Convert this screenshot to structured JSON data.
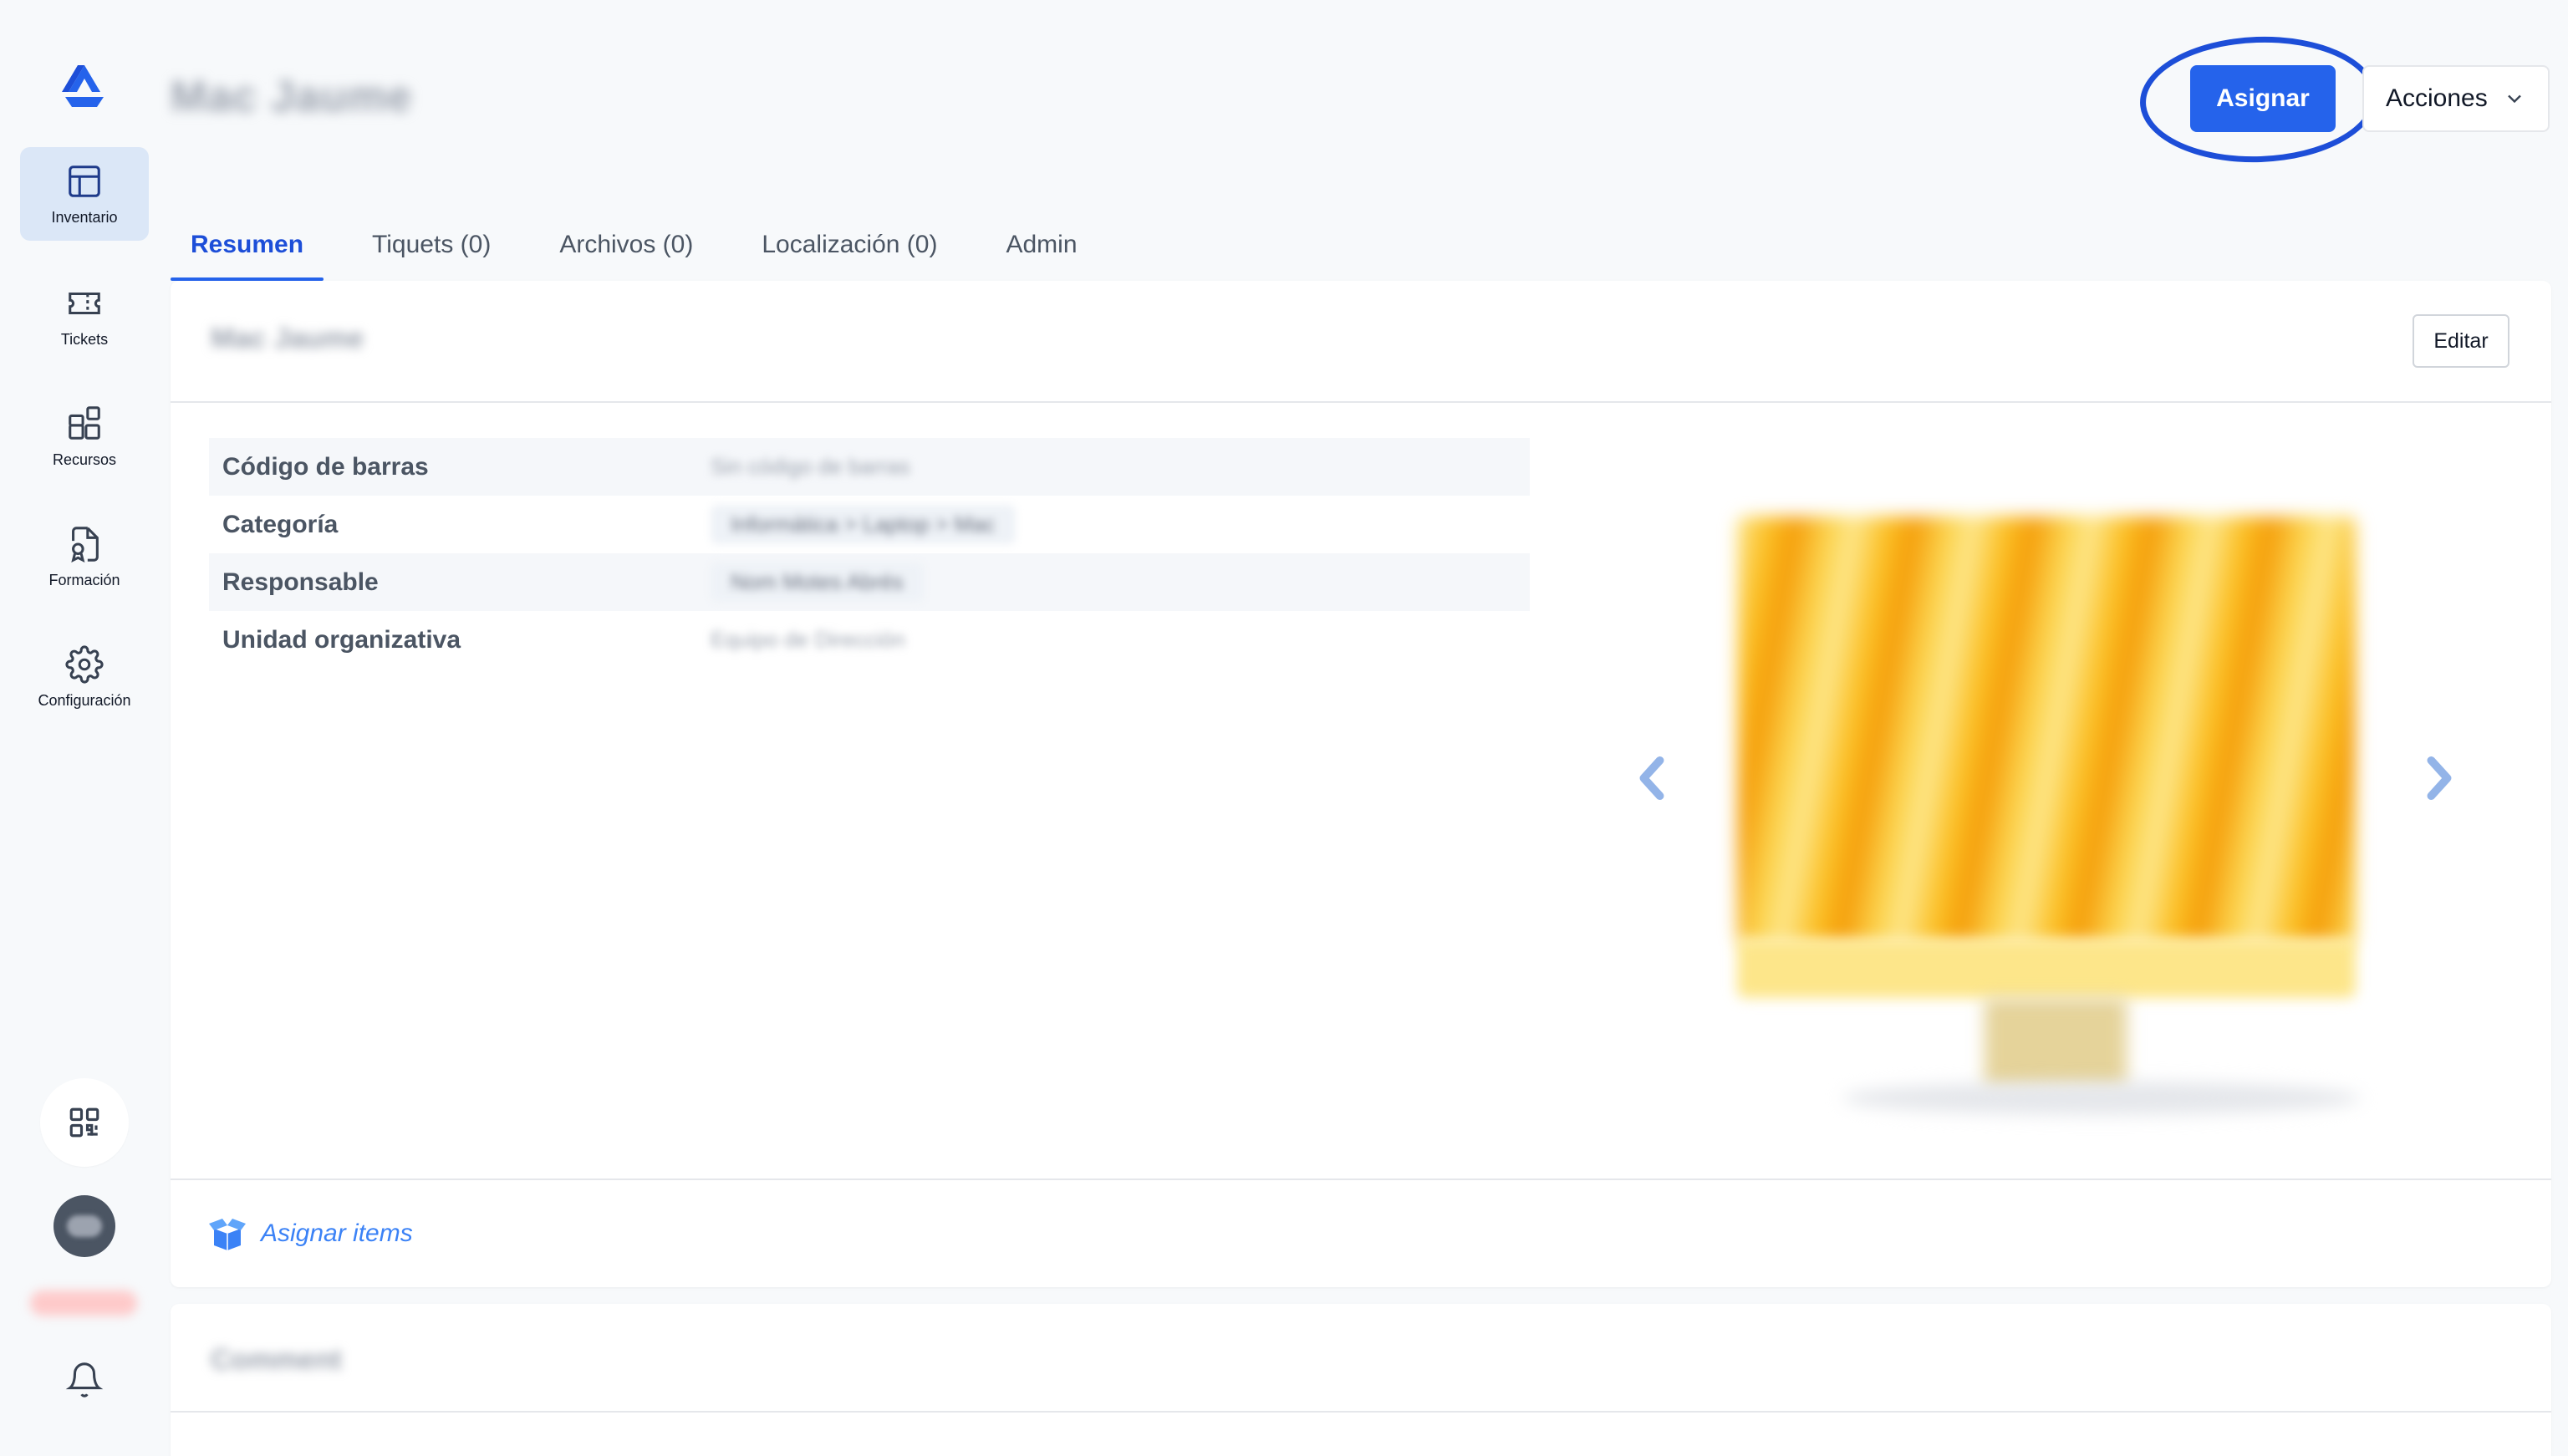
{
  "sidebar": {
    "items": [
      {
        "label": "Inventario",
        "icon": "table-grid-icon",
        "active": true
      },
      {
        "label": "Tickets",
        "icon": "ticket-icon",
        "active": false
      },
      {
        "label": "Recursos",
        "icon": "shapes-icon",
        "active": false
      },
      {
        "label": "Formación",
        "icon": "certificate-icon",
        "active": false
      },
      {
        "label": "Configuración",
        "icon": "gear-icon",
        "active": false
      }
    ],
    "qr_icon": "qr-code-icon",
    "bell_icon": "bell-icon"
  },
  "header": {
    "title": "Mac Jaume",
    "assign_label": "Asignar",
    "actions_label": "Acciones"
  },
  "tabs": [
    {
      "label": "Resumen",
      "active": true
    },
    {
      "label": "Tiquets (0)",
      "active": false
    },
    {
      "label": "Archivos (0)",
      "active": false
    },
    {
      "label": "Localización (0)",
      "active": false
    },
    {
      "label": "Admin",
      "active": false
    }
  ],
  "summary": {
    "title": "Mac Jaume",
    "edit_label": "Editar",
    "properties": [
      {
        "key": "Código de barras",
        "value": "Sin código de barras"
      },
      {
        "key": "Categoría",
        "value": "Informática > Laptop > Mac"
      },
      {
        "key": "Responsable",
        "value": "Nom Motes Abrés"
      },
      {
        "key": "Unidad organizativa",
        "value": "Equipo de Dirección"
      }
    ],
    "footer_link": "Asignar items"
  },
  "comment_card": {
    "title": "Comment"
  },
  "colors": {
    "primary": "#2563eb",
    "highlight": "#1d4ed8",
    "active_nav_bg": "#dbe7f7"
  }
}
